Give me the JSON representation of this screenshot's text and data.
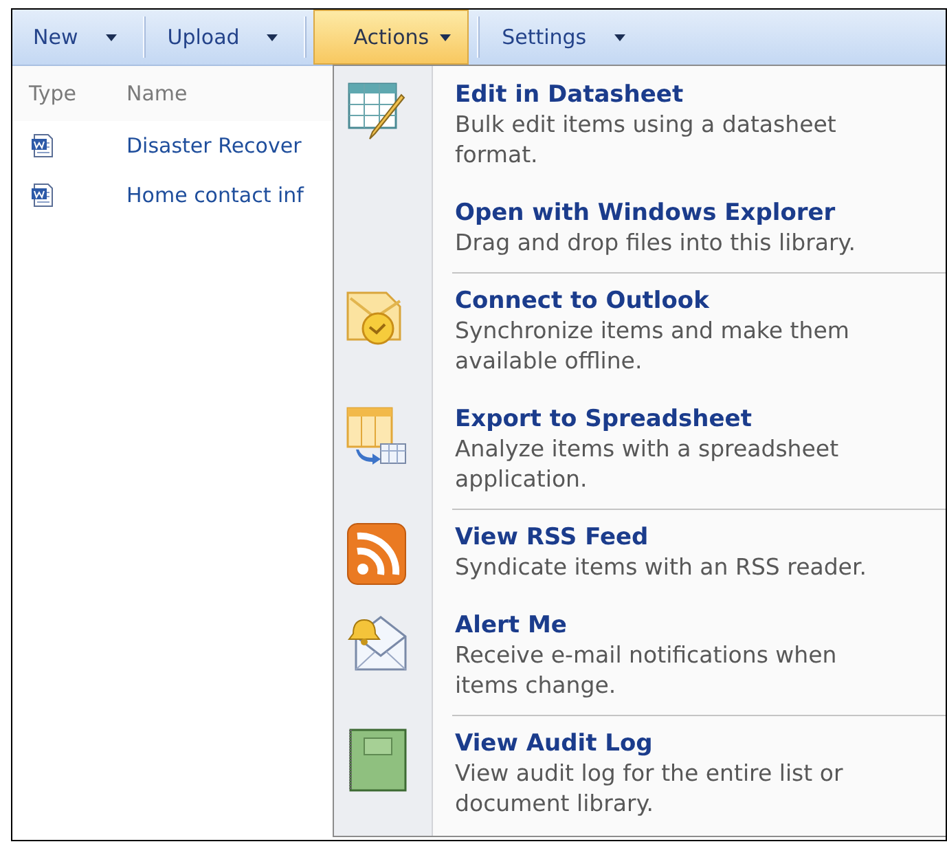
{
  "toolbar": {
    "items": [
      {
        "label": "New",
        "selected": false
      },
      {
        "label": "Upload",
        "selected": false
      },
      {
        "label": "Actions",
        "selected": true
      },
      {
        "label": "Settings",
        "selected": false
      }
    ]
  },
  "list": {
    "columns": [
      "Type",
      "Name"
    ],
    "rows": [
      {
        "name": "Disaster Recover"
      },
      {
        "name": "Home contact inf"
      }
    ]
  },
  "menu": {
    "items": [
      {
        "kind": "datasheet",
        "title": "Edit in Datasheet",
        "description": "Bulk edit items using a datasheet format.",
        "separator_before": false
      },
      {
        "kind": "explorer",
        "title": "Open with Windows Explorer",
        "description": "Drag and drop files into this library.",
        "separator_before": false
      },
      {
        "kind": "outlook",
        "title": "Connect to Outlook",
        "description": "Synchronize items and make them available offline.",
        "separator_before": true
      },
      {
        "kind": "spreadsheet",
        "title": "Export to Spreadsheet",
        "description": "Analyze items with a spreadsheet application.",
        "separator_before": false
      },
      {
        "kind": "rss",
        "title": "View RSS Feed",
        "description": "Syndicate items with an RSS reader.",
        "separator_before": true
      },
      {
        "kind": "alert",
        "title": "Alert Me",
        "description": "Receive e-mail notifications when items change.",
        "separator_before": false
      },
      {
        "kind": "audit",
        "title": "View Audit Log",
        "description": "View audit log for the entire list or document library.",
        "separator_before": true
      }
    ]
  }
}
